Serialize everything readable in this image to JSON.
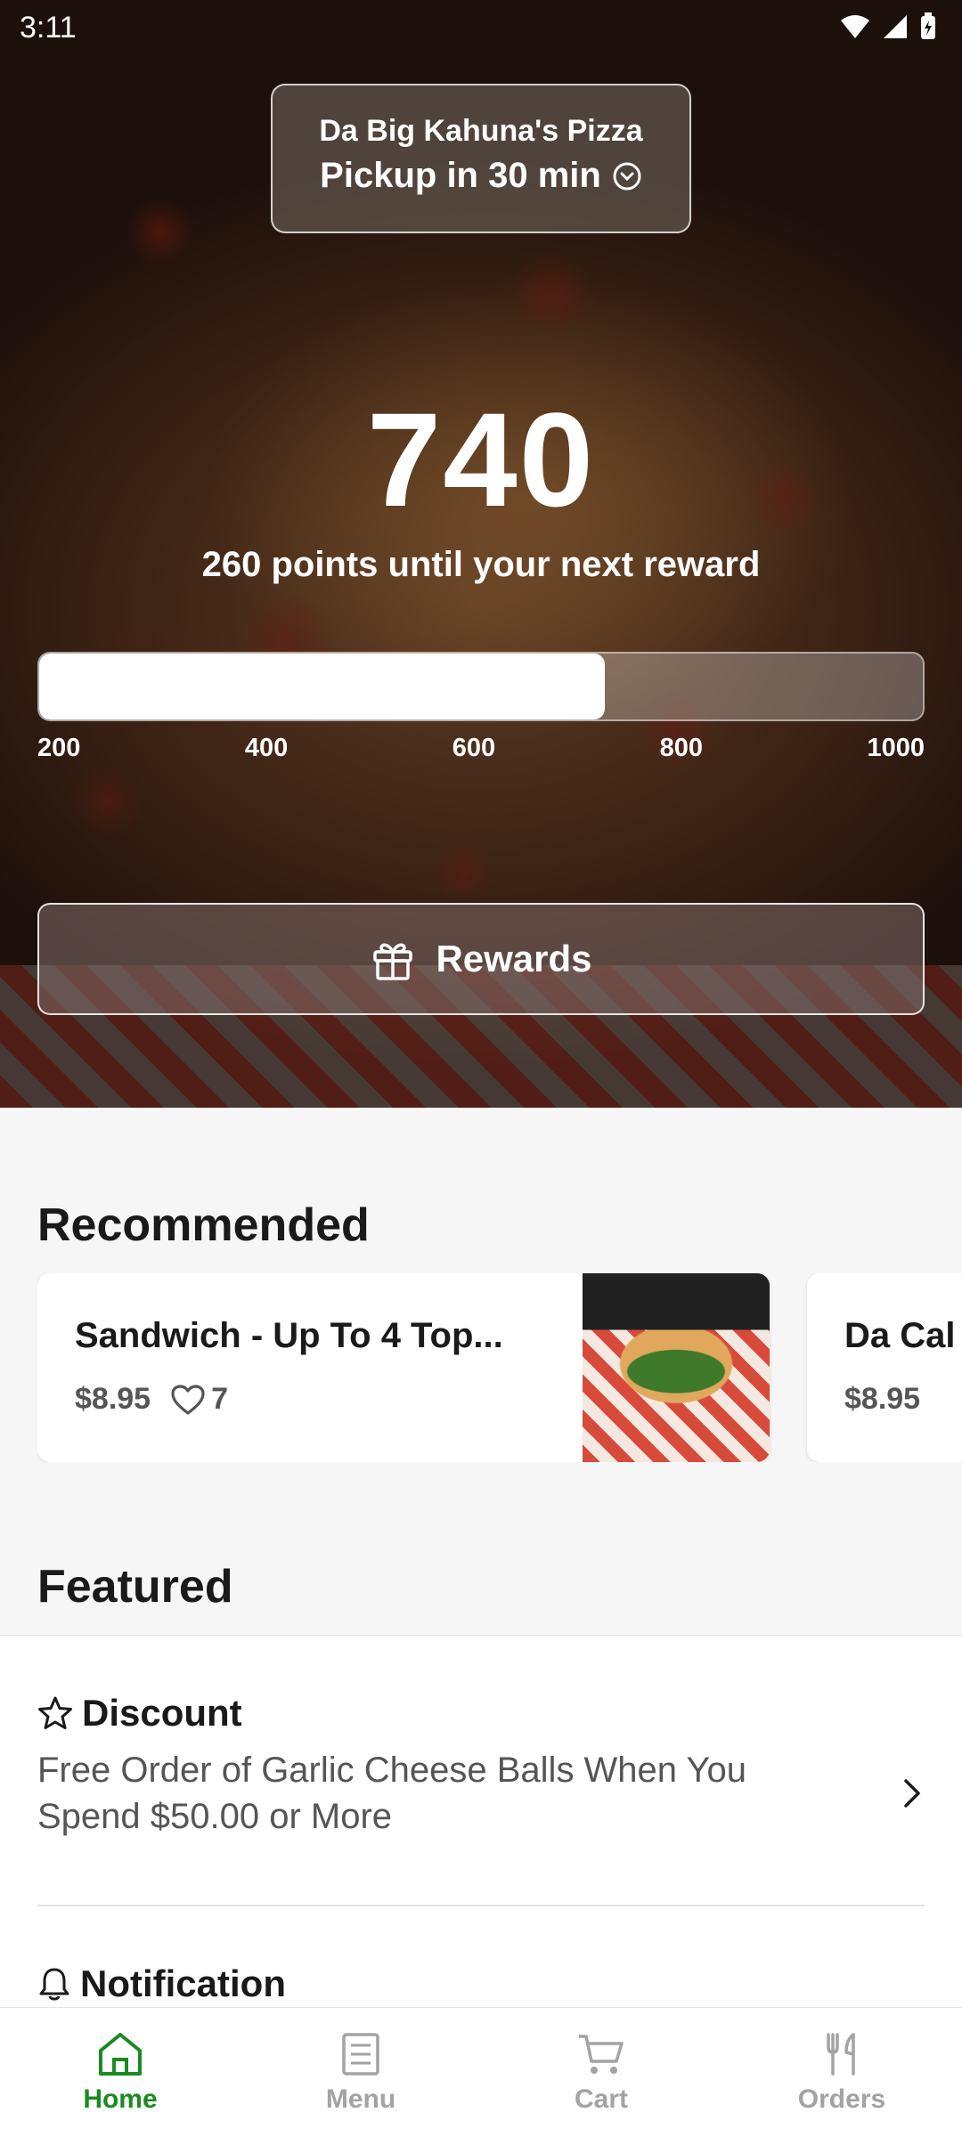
{
  "status_bar": {
    "time": "3:11"
  },
  "store": {
    "name": "Da Big Kahuna's Pizza",
    "pickup": "Pickup in 30 min"
  },
  "loyalty": {
    "points": "740",
    "subtitle": "260 points until your next reward",
    "progress_fraction": 0.64,
    "ticks": [
      "200",
      "400",
      "600",
      "800",
      "1000"
    ],
    "rewards_label": "Rewards"
  },
  "recommended": {
    "title": "Recommended",
    "items": [
      {
        "name": "Sandwich - Up To 4 Top...",
        "price": "$8.95",
        "likes": "7"
      },
      {
        "name": "Da Cal",
        "price": "$8.95"
      }
    ]
  },
  "featured": {
    "title": "Featured",
    "items": [
      {
        "type": "Discount",
        "description": "Free Order of Garlic Cheese Balls When You Spend $50.00 or More"
      },
      {
        "type": "Notification"
      }
    ]
  },
  "nav": {
    "items": [
      {
        "label": "Home",
        "active": true
      },
      {
        "label": "Menu"
      },
      {
        "label": "Cart"
      },
      {
        "label": "Orders"
      }
    ],
    "active_color": "#1b8a22"
  }
}
